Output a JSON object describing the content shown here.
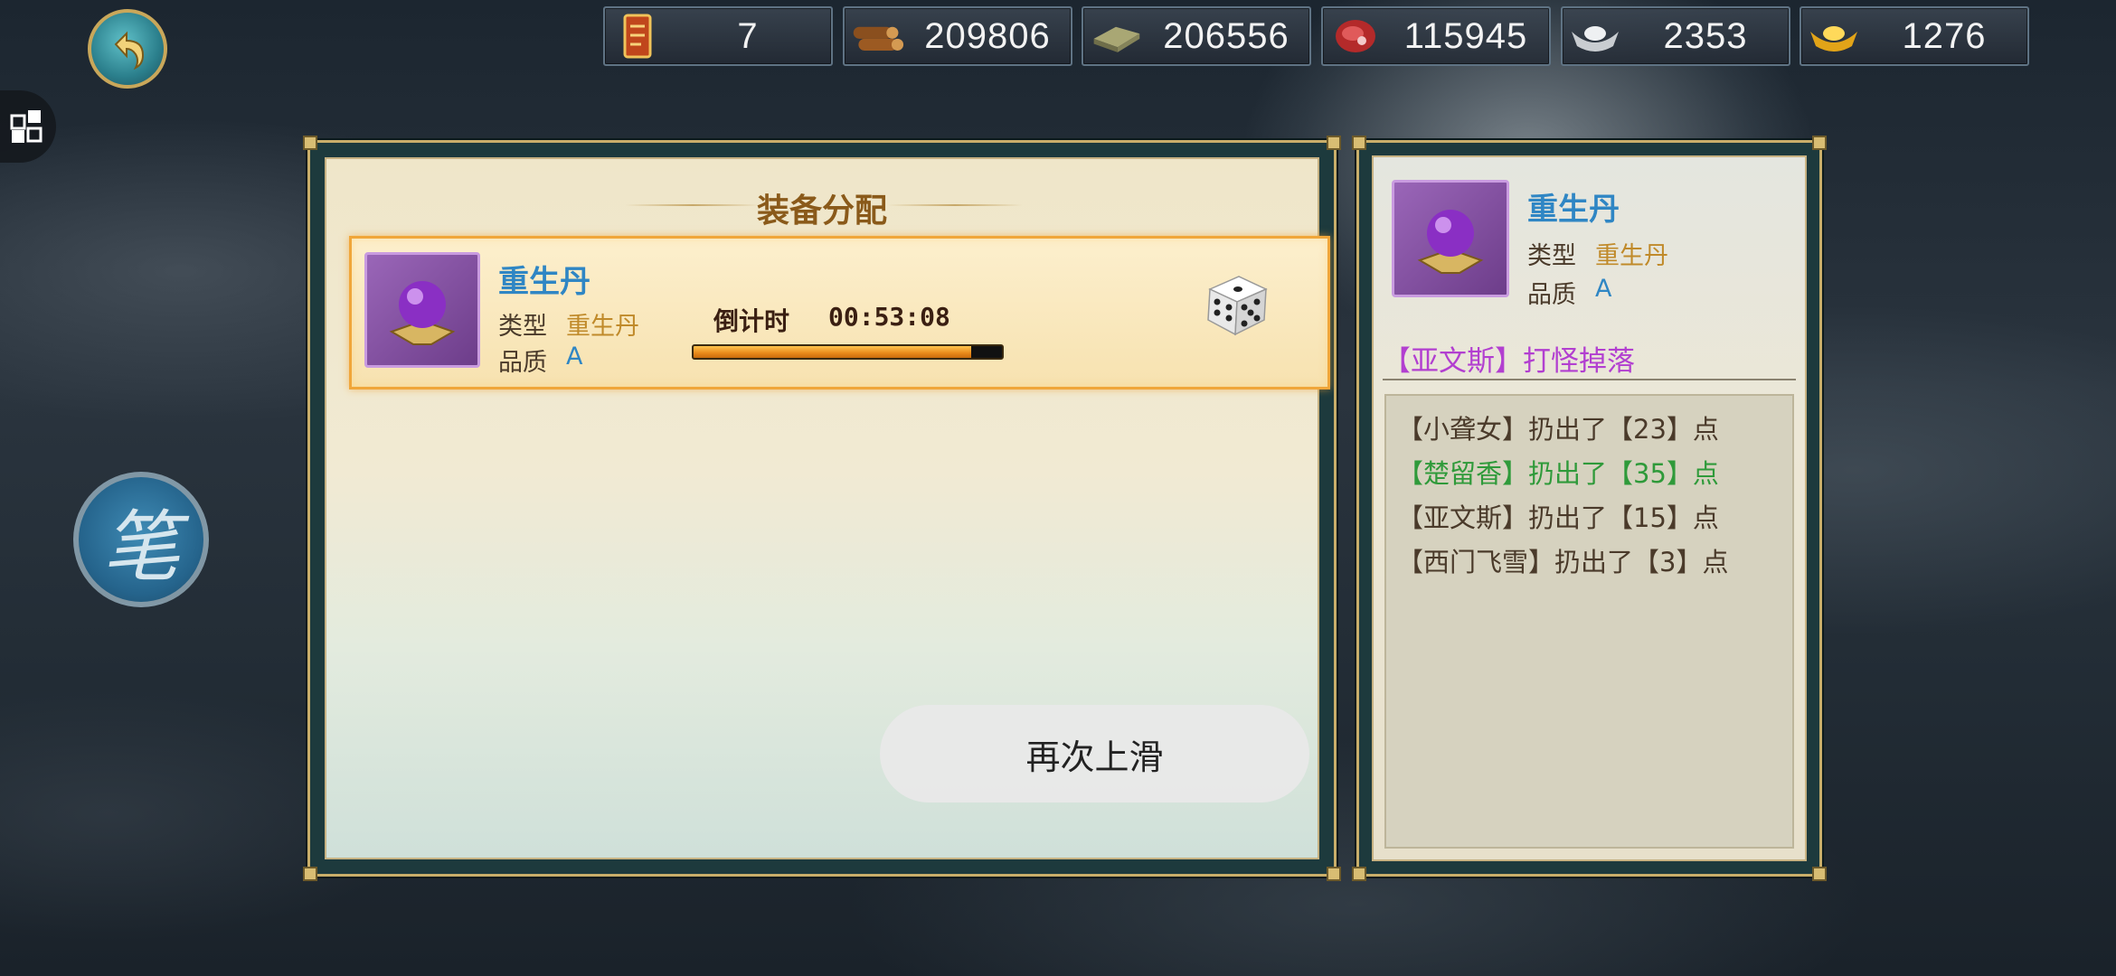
{
  "resources": [
    {
      "icon": "scroll-token-icon",
      "value": "7"
    },
    {
      "icon": "wood-logs-icon",
      "value": "209806"
    },
    {
      "icon": "stone-slab-icon",
      "value": "206556"
    },
    {
      "icon": "meat-icon",
      "value": "115945"
    },
    {
      "icon": "silver-ingot-icon",
      "value": "2353"
    },
    {
      "icon": "gold-ingot-icon",
      "value": "1276"
    }
  ],
  "panel": {
    "title": "装备分配",
    "item": {
      "name": "重生丹",
      "type_label": "类型",
      "type_value": "重生丹",
      "quality_label": "品质",
      "quality_value": "A",
      "countdown_label": "倒计时",
      "countdown_value": "00:53:08",
      "progress": 0.9
    }
  },
  "detail": {
    "name": "重生丹",
    "type_label": "类型",
    "type_value": "重生丹",
    "quality_label": "品质",
    "quality_value": "A",
    "source": "【亚文斯】打怪掉落",
    "log": [
      {
        "text": "【小聋女】扔出了【23】点",
        "color": "#4a3a2a"
      },
      {
        "text": "【楚留香】扔出了【35】点",
        "color": "#2f9a3a"
      },
      {
        "text": "【亚文斯】扔出了【15】点",
        "color": "#4a3a2a"
      },
      {
        "text": "【西门飞雪】扔出了【3】点",
        "color": "#4a3a2a"
      }
    ]
  },
  "toast": {
    "text": "再次上滑"
  },
  "brush_button": {
    "label": "笔"
  }
}
